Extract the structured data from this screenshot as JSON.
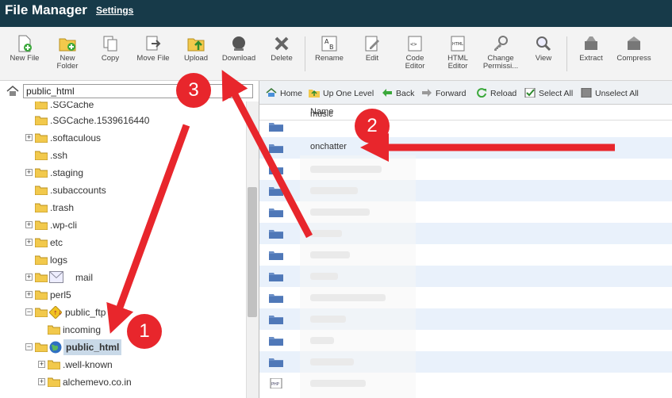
{
  "app": {
    "title": "File Manager",
    "settings": "Settings"
  },
  "toolbar": [
    {
      "label": "New File",
      "icon": "new-file-icon"
    },
    {
      "label": "New Folder",
      "icon": "new-folder-icon"
    },
    {
      "label": "Copy",
      "icon": "copy-icon"
    },
    {
      "label": "Move File",
      "icon": "move-file-icon"
    },
    {
      "label": "Upload",
      "icon": "upload-icon"
    },
    {
      "label": "Download",
      "icon": "download-icon"
    },
    {
      "label": "Delete",
      "icon": "delete-icon"
    },
    {
      "label": "Rename",
      "icon": "rename-icon"
    },
    {
      "label": "Edit",
      "icon": "edit-icon"
    },
    {
      "label": "Code Editor",
      "icon": "code-editor-icon"
    },
    {
      "label": "HTML Editor",
      "icon": "html-editor-icon"
    },
    {
      "label": "Change Permissi...",
      "icon": "change-permissions-icon"
    },
    {
      "label": "View",
      "icon": "view-icon"
    },
    {
      "label": "Extract",
      "icon": "extract-icon"
    },
    {
      "label": "Compress",
      "icon": "compress-icon"
    }
  ],
  "path": {
    "value": "public_html"
  },
  "tree": [
    {
      "label": ".SGCache",
      "expander": false
    },
    {
      "label": ".SGCache.1539616440",
      "expander": false
    },
    {
      "label": ".softaculous",
      "expander": true
    },
    {
      "label": ".ssh",
      "expander": false
    },
    {
      "label": ".staging",
      "expander": true
    },
    {
      "label": ".subaccounts",
      "expander": false
    },
    {
      "label": ".trash",
      "expander": false
    },
    {
      "label": ".wp-cli",
      "expander": true
    },
    {
      "label": "etc",
      "expander": true
    },
    {
      "label": "logs",
      "expander": false
    },
    {
      "label": "mail",
      "expander": true
    },
    {
      "label": "perl5",
      "expander": true
    },
    {
      "label": "public_ftp",
      "expander": true
    },
    {
      "label": "incoming",
      "expander": false
    },
    {
      "label": "public_html",
      "expander": true
    },
    {
      "label": ".well-known",
      "expander": true
    },
    {
      "label": "alchemevo.co.in",
      "expander": true
    }
  ],
  "nav": {
    "home": "Home",
    "up": "Up One Level",
    "back": "Back",
    "forward": "Forward",
    "reload": "Reload",
    "select_all": "Select All",
    "unselect_all": "Unselect All"
  },
  "files": {
    "column_name": "Name",
    "rows": [
      "music",
      "onchatter"
    ]
  },
  "annotations": {
    "badge1": "1",
    "badge2": "2",
    "badge3": "3"
  },
  "colors": {
    "header": "#173a49",
    "arrow": "#e8262c",
    "selected": "#c9d9e8",
    "row_alt": "#e9f1fb"
  }
}
